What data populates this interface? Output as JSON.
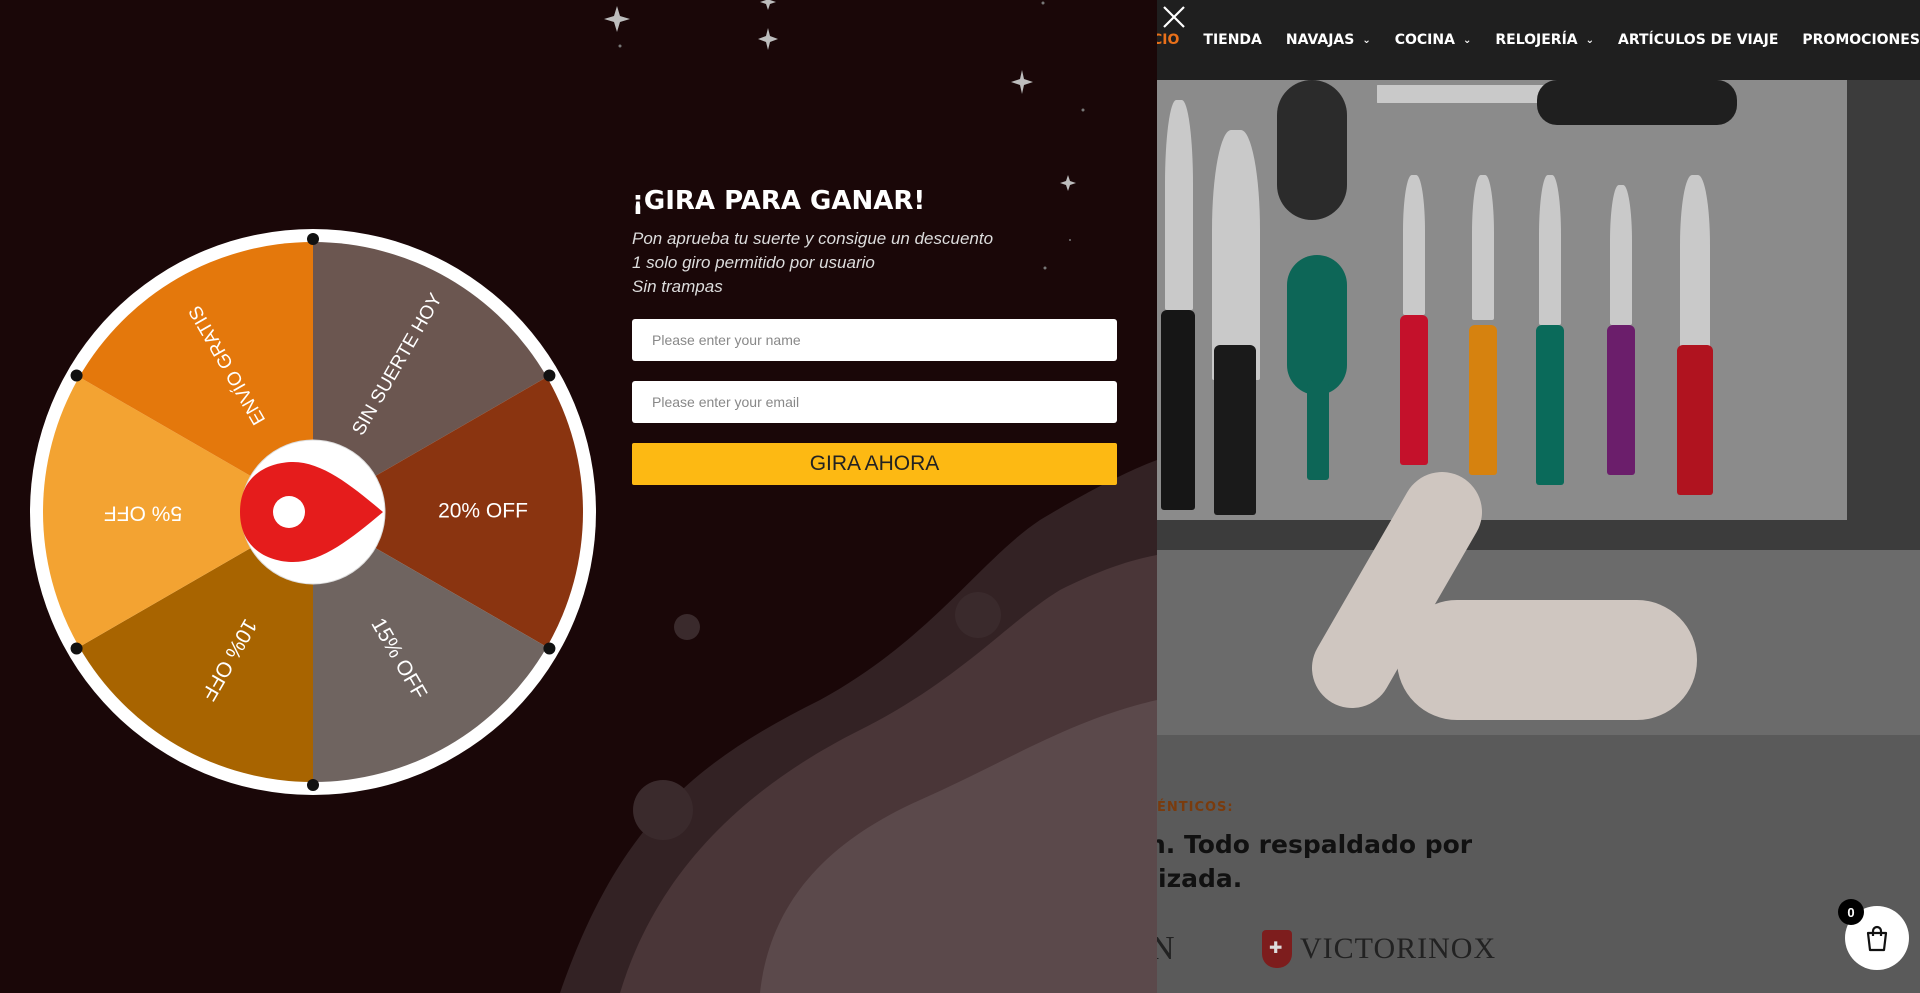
{
  "site": {
    "nav": [
      {
        "label": "CIO",
        "has_dropdown": false,
        "active": true
      },
      {
        "label": "TIENDA",
        "has_dropdown": false
      },
      {
        "label": "NAVAJAS",
        "has_dropdown": true
      },
      {
        "label": "COCINA",
        "has_dropdown": true
      },
      {
        "label": "RELOJERÍA",
        "has_dropdown": true
      },
      {
        "label": "ARTÍCULOS DE VIAJE",
        "has_dropdown": false
      },
      {
        "label": "PROMOCIONES",
        "has_dropdown": false
      }
    ],
    "kicker": "ÉNTICOS:",
    "headline_line1": "n. Todo respaldado por",
    "headline_line2": "izada.",
    "brand_partial": "N",
    "brand": "VICTORINOX",
    "cart_count": "0",
    "cart_icon": "shopping-bag-icon"
  },
  "popup": {
    "close_icon": "close-icon",
    "title": "¡GIRA PARA GANAR!",
    "subtitle_lines": [
      "Pon aprueba tu suerte y consigue un descuento",
      "1 solo giro permitido por usuario",
      "Sin trampas"
    ],
    "name_placeholder": "Please enter your name",
    "email_placeholder": "Please enter your email",
    "button_label": "GIRA AHORA",
    "wheel": {
      "segments": [
        {
          "label": "SIN SUERTE HOY",
          "color": "#6b5650"
        },
        {
          "label": "20% OFF",
          "color": "#8a3410"
        },
        {
          "label": "15% OFF",
          "color": "#6f6460"
        },
        {
          "label": "10% OFF",
          "color": "#a86400"
        },
        {
          "label": "5% OFF",
          "color": "#f3a332"
        },
        {
          "label": "ENVÍO GRATIS",
          "color": "#e4780c"
        }
      ],
      "pointer_color": "#e51c1c"
    }
  },
  "colors": {
    "accent": "#e8701a",
    "button": "#fdb913",
    "popup_bg": "#1a0708"
  }
}
